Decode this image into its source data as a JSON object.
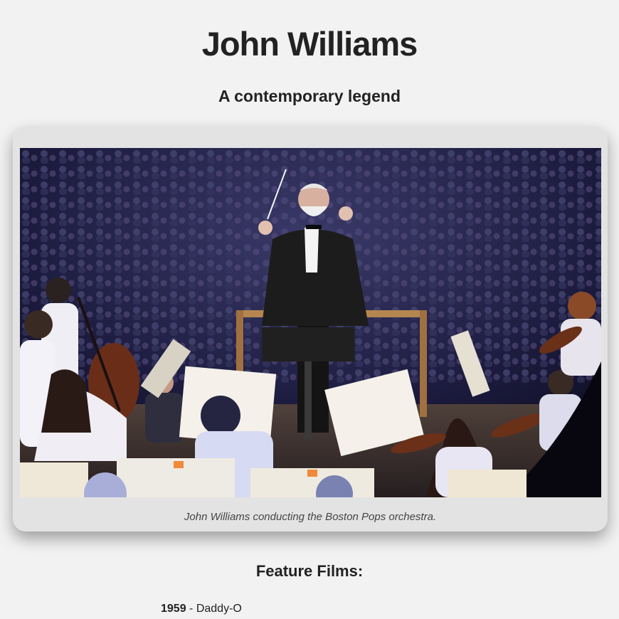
{
  "header": {
    "title": "John Williams",
    "subtitle": "A contemporary legend"
  },
  "figure": {
    "image_label": "John Williams conducting an orchestra on stage",
    "caption": "John Williams conducting the Boston Pops orchestra."
  },
  "films": {
    "heading": "Feature Films:",
    "separator": " - ",
    "items": [
      {
        "year": "1959",
        "title": "Daddy-O"
      }
    ]
  },
  "colors": {
    "background": "#f2f2f2",
    "card": "#e3e3e3",
    "text": "#222222",
    "caption": "#444444"
  }
}
